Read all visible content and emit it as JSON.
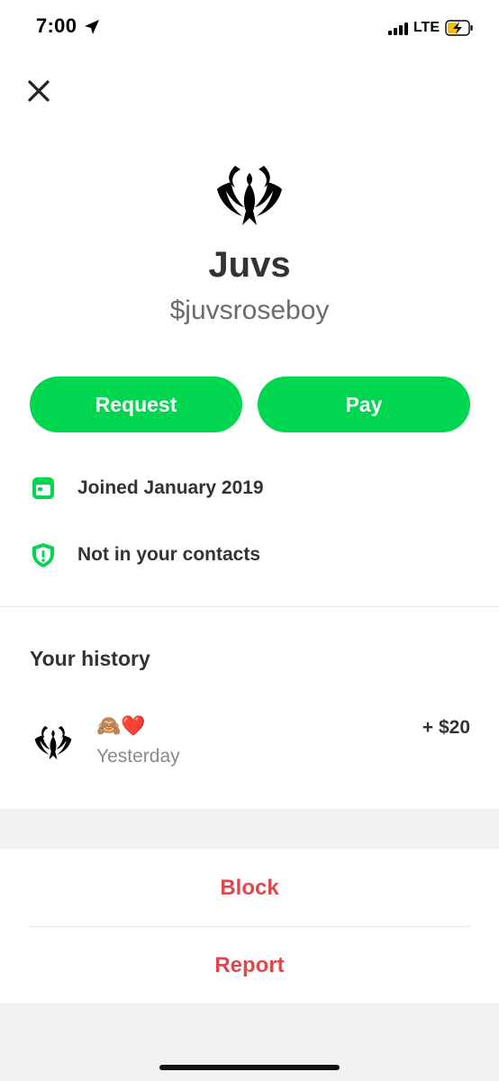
{
  "status_bar": {
    "time": "7:00",
    "network": "LTE",
    "location_icon": "location-arrow-icon",
    "signal_icon": "signal-bars-icon",
    "battery_icon": "battery-charging-icon"
  },
  "header": {
    "close_icon": "close-icon"
  },
  "profile": {
    "avatar_icon": "phoenix-logo-icon",
    "name": "Juvs",
    "handle": "$juvsroseboy"
  },
  "actions": {
    "request_label": "Request",
    "pay_label": "Pay"
  },
  "info": {
    "joined": {
      "icon": "calendar-icon",
      "text": "Joined January 2019"
    },
    "contacts": {
      "icon": "shield-alert-icon",
      "text": "Not in your contacts"
    }
  },
  "history": {
    "title": "Your history",
    "items": [
      {
        "note": "🙈❤️",
        "date": "Yesterday",
        "amount": "+ $20"
      }
    ]
  },
  "footer": {
    "block_label": "Block",
    "report_label": "Report"
  },
  "colors": {
    "accent_green": "#00d64f",
    "danger_red": "#e0474c",
    "text_dark": "#333333",
    "text_muted": "#8a8a8a"
  }
}
